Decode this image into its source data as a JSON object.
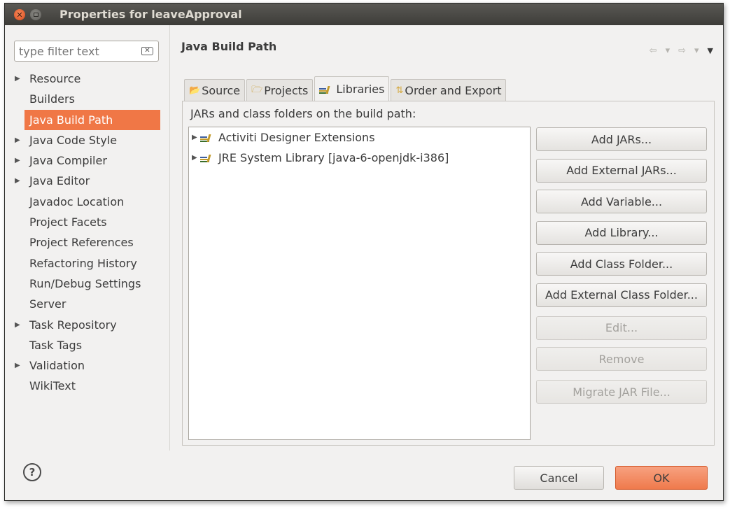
{
  "window": {
    "title": "Properties for leaveApproval"
  },
  "sidebar": {
    "filter_placeholder": "type filter text",
    "items": [
      {
        "label": "Resource",
        "expandable": true,
        "selected": false
      },
      {
        "label": "Builders",
        "expandable": false,
        "selected": false
      },
      {
        "label": "Java Build Path",
        "expandable": false,
        "selected": true
      },
      {
        "label": "Java Code Style",
        "expandable": true,
        "selected": false
      },
      {
        "label": "Java Compiler",
        "expandable": true,
        "selected": false
      },
      {
        "label": "Java Editor",
        "expandable": true,
        "selected": false
      },
      {
        "label": "Javadoc Location",
        "expandable": false,
        "selected": false
      },
      {
        "label": "Project Facets",
        "expandable": false,
        "selected": false
      },
      {
        "label": "Project References",
        "expandable": false,
        "selected": false
      },
      {
        "label": "Refactoring History",
        "expandable": false,
        "selected": false
      },
      {
        "label": "Run/Debug Settings",
        "expandable": false,
        "selected": false
      },
      {
        "label": "Server",
        "expandable": false,
        "selected": false
      },
      {
        "label": "Task Repository",
        "expandable": true,
        "selected": false
      },
      {
        "label": "Task Tags",
        "expandable": false,
        "selected": false
      },
      {
        "label": "Validation",
        "expandable": true,
        "selected": false
      },
      {
        "label": "WikiText",
        "expandable": false,
        "selected": false
      }
    ]
  },
  "main": {
    "title": "Java Build Path",
    "tabs": [
      {
        "label": "Source",
        "icon": "source-folder-icon",
        "active": false
      },
      {
        "label": "Projects",
        "icon": "projects-folder-icon",
        "active": false
      },
      {
        "label": "Libraries",
        "icon": "libraries-icon",
        "active": true
      },
      {
        "label": "Order and Export",
        "icon": "order-export-icon",
        "active": false
      }
    ],
    "panel_label": "JARs and class folders on the build path:",
    "libraries": [
      {
        "label": "Activiti Designer Extensions"
      },
      {
        "label": "JRE System Library [java-6-openjdk-i386]"
      }
    ],
    "buttons": {
      "add_jars": "Add JARs...",
      "add_external_jars": "Add External JARs...",
      "add_variable": "Add Variable...",
      "add_library": "Add Library...",
      "add_class_folder": "Add Class Folder...",
      "add_external_class_folder": "Add External Class Folder...",
      "edit": "Edit...",
      "remove": "Remove",
      "migrate_jar": "Migrate JAR File..."
    }
  },
  "footer": {
    "cancel": "Cancel",
    "ok": "OK"
  },
  "colors": {
    "selection": "#f07746",
    "ok_button": "#ef7a4c",
    "titlebar": "#3d3c38"
  }
}
